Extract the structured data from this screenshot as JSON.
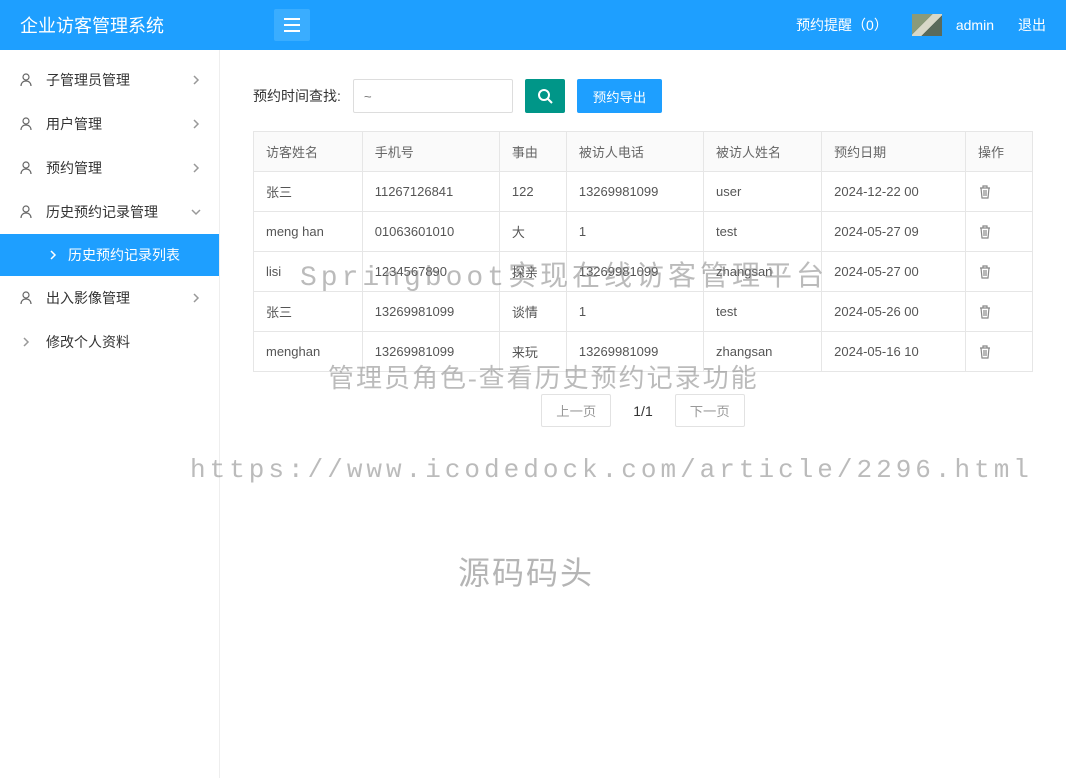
{
  "header": {
    "title": "企业访客管理系统",
    "reminder": "预约提醒（0）",
    "username": "admin",
    "logout": "退出"
  },
  "sidebar": {
    "items": [
      {
        "label": "子管理员管理",
        "expanded": false
      },
      {
        "label": "用户管理",
        "expanded": false
      },
      {
        "label": "预约管理",
        "expanded": false
      },
      {
        "label": "历史预约记录管理",
        "expanded": true,
        "sub": [
          {
            "label": "历史预约记录列表"
          }
        ]
      },
      {
        "label": "出入影像管理",
        "expanded": false
      },
      {
        "label": "修改个人资料",
        "no_icon": true
      }
    ]
  },
  "search": {
    "label": "预约时间查找:",
    "placeholder": "~",
    "export": "预约导出"
  },
  "table": {
    "headers": [
      "访客姓名",
      "手机号",
      "事由",
      "被访人电话",
      "被访人姓名",
      "预约日期",
      "操作"
    ],
    "rows": [
      {
        "c": [
          "张三",
          "11267126841",
          "122",
          "13269981099",
          "user",
          "2024-12-22 00"
        ]
      },
      {
        "c": [
          "meng han",
          "01063601010",
          "大",
          "1",
          "test",
          "2024-05-27 09"
        ]
      },
      {
        "c": [
          "lisi",
          "1234567890",
          "探亲",
          "13269981099",
          "zhangsan",
          "2024-05-27 00"
        ]
      },
      {
        "c": [
          "张三",
          "13269981099",
          "谈情",
          "1",
          "test",
          "2024-05-26 00"
        ]
      },
      {
        "c": [
          "menghan",
          "13269981099",
          "来玩",
          "13269981099",
          "zhangsan",
          "2024-05-16 10"
        ]
      }
    ]
  },
  "pagination": {
    "prev": "上一页",
    "info": "1/1",
    "next": "下一页"
  },
  "watermarks": {
    "w1": "Springboot实现在线访客管理平台",
    "w2": "管理员角色-查看历史预约记录功能",
    "w3": "https://www.icodedock.com/article/2296.html",
    "w4": "源码码头"
  }
}
